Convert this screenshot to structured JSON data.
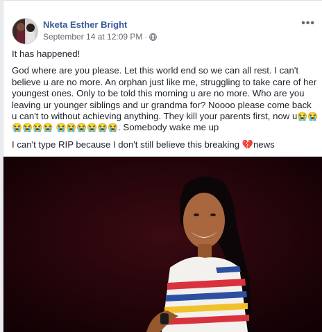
{
  "post": {
    "author": "Nketa Esther Bright",
    "timestamp": "September 14 at 12:09 PM",
    "separator": "·",
    "privacy_icon": "globe-icon",
    "more_icon": "ellipsis-icon",
    "more_label": "•••",
    "paragraph_1": "It has happened!",
    "paragraph_2_text": "God where are you please. Let this world end so we can all rest. I can't believe u are no more. An orphan just like me, struggling to take care of her youngest ones. Only to be told this morning u are no more. Who are you leaving ur younger siblings and ur grandma for? Noooo please come back u can't to without achieving anything. They kill your parents first, now u",
    "paragraph_2_emojis_a": "😭😭😭😭😭😭",
    "paragraph_2_emojis_b": "😭😭😭😭😭😭",
    "paragraph_2_tail": ". Somebody wake me up",
    "paragraph_3_a": "I can't type RIP because I don't still believe this breaking ",
    "paragraph_3_emoji": "💔",
    "paragraph_3_b": "news"
  },
  "colors": {
    "author_link": "#385898",
    "meta_text": "#616770",
    "body_text": "#1d2129",
    "photo_background": "#1a0206"
  }
}
